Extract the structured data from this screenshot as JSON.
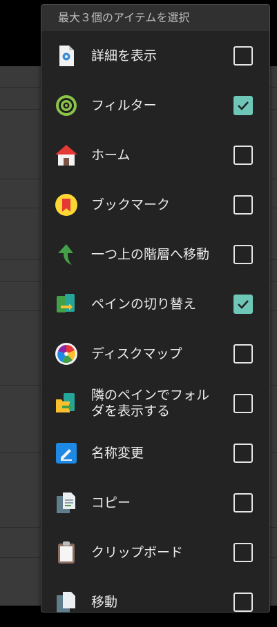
{
  "dialog": {
    "title": "最大３個のアイテムを選択",
    "items": [
      {
        "label": "詳細を表示",
        "icon": "info-document-icon",
        "checked": false
      },
      {
        "label": "フィルター",
        "icon": "filter-target-icon",
        "checked": true
      },
      {
        "label": "ホーム",
        "icon": "home-icon",
        "checked": false
      },
      {
        "label": "ブックマーク",
        "icon": "bookmark-icon",
        "checked": false
      },
      {
        "label": "一つ上の階層へ移動",
        "icon": "up-arrow-icon",
        "checked": false
      },
      {
        "label": "ペインの切り替え",
        "icon": "switch-pane-icon",
        "checked": true
      },
      {
        "label": "ディスクマップ",
        "icon": "disk-map-icon",
        "checked": false
      },
      {
        "label": "隣のペインでフォルダを表示する",
        "icon": "folder-in-pane-icon",
        "checked": false
      },
      {
        "label": "名称変更",
        "icon": "rename-icon",
        "checked": false
      },
      {
        "label": "コピー",
        "icon": "copy-icon",
        "checked": false
      },
      {
        "label": "クリップボード",
        "icon": "clipboard-icon",
        "checked": false
      },
      {
        "label": "移動",
        "icon": "move-icon",
        "checked": false
      }
    ]
  },
  "colors": {
    "check_accent": "#6ec6b6",
    "dialog_bg": "#232323",
    "header_bg": "#303030"
  }
}
